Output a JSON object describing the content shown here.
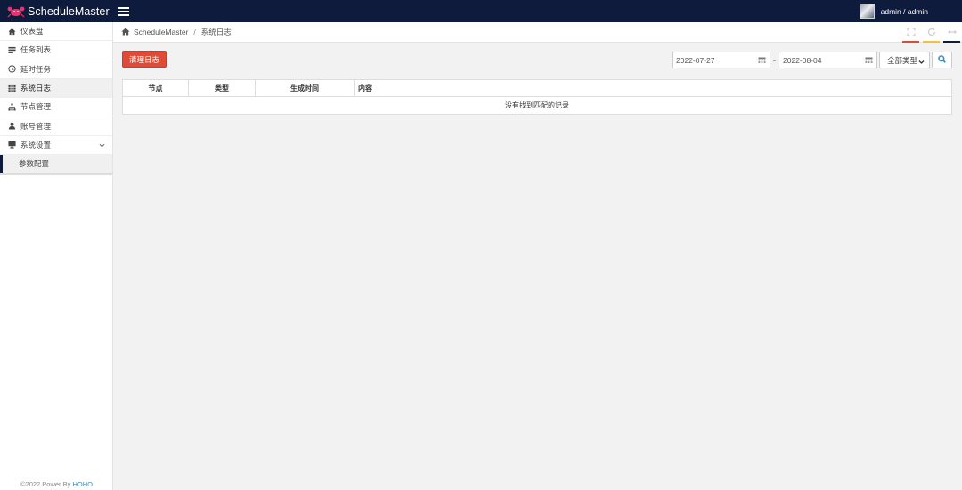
{
  "app": {
    "name": "ScheduleMaster",
    "logo_icon": "crab-logo-icon",
    "accent": "#0f1b3d"
  },
  "user": {
    "label": "admin / admin"
  },
  "sidebar": {
    "items": [
      {
        "label": "仪表盘",
        "icon": "home-icon"
      },
      {
        "label": "任务列表",
        "icon": "list-icon"
      },
      {
        "label": "延时任务",
        "icon": "clock-icon"
      },
      {
        "label": "系统日志",
        "icon": "grid-icon"
      },
      {
        "label": "节点管理",
        "icon": "sitemap-icon"
      },
      {
        "label": "账号管理",
        "icon": "user-icon"
      },
      {
        "label": "系统设置",
        "icon": "monitor-icon"
      },
      {
        "label": "参数配置",
        "icon": "sub-item-icon"
      }
    ],
    "copyright_prefix": "©2022 Power By ",
    "copyright_link": "HOHO"
  },
  "breadcrumb": {
    "root": "ScheduleMaster",
    "sep": "/",
    "current": "系统日志"
  },
  "toolbar": {
    "clean_label": "清理日志",
    "date_from": "2022-07-27",
    "date_to": "2022-08-04",
    "date_sep": "-",
    "type_selected": "全部类型"
  },
  "table": {
    "columns": [
      "节点",
      "类型",
      "生成时间",
      "内容"
    ],
    "empty_text": "没有找到匹配的记录"
  },
  "colors": {
    "danger": "#dd4b39",
    "tab_red": "#dd4b39",
    "tab_yellow": "#f0c040",
    "tab_navy": "#0f1b3d"
  }
}
